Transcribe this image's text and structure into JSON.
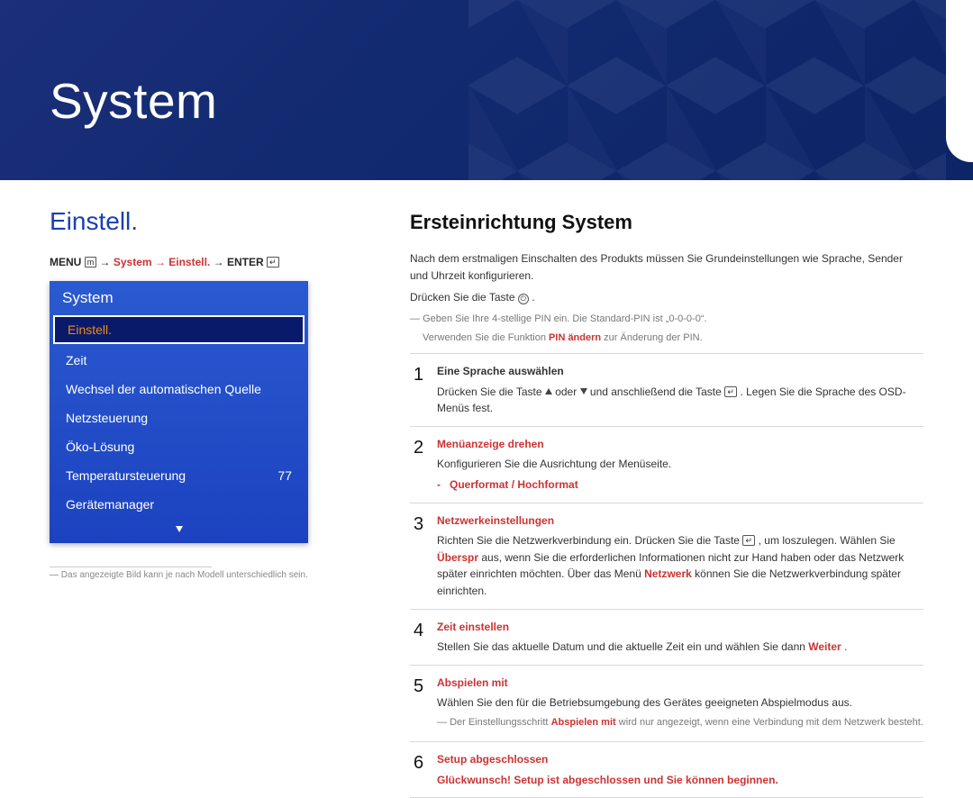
{
  "hero": {
    "title": "System"
  },
  "left": {
    "section_title": "Einstell.",
    "breadcrumb": {
      "menu": "MENU",
      "arrow": "→",
      "red": "System → Einstell.",
      "enter": "ENTER"
    },
    "osd": {
      "title": "System",
      "rows": [
        {
          "label": "Einstell.",
          "value": "",
          "selected": true
        },
        {
          "label": "Zeit",
          "value": ""
        },
        {
          "label": "Wechsel der automatischen Quelle",
          "value": ""
        },
        {
          "label": "Netzsteuerung",
          "value": ""
        },
        {
          "label": "Öko-Lösung",
          "value": ""
        },
        {
          "label": "Temperatursteuerung",
          "value": "77"
        },
        {
          "label": "Gerätemanager",
          "value": ""
        }
      ]
    },
    "footnote": "Das angezeigte Bild kann je nach Modell unterschiedlich sein."
  },
  "right": {
    "title": "Ersteinrichtung System",
    "intro1": "Nach dem erstmaligen Einschalten des Produkts müssen Sie Grundeinstellungen wie Sprache, Sender und Uhrzeit konfigurieren.",
    "intro2_a": "Drücken Sie die Taste ",
    "intro2_b": ".",
    "note1": "Geben Sie Ihre 4-stellige PIN ein. Die Standard-PIN ist „0-0-0-0“.",
    "note2_a": "Verwenden Sie die Funktion ",
    "note2_red": "PIN ändern",
    "note2_b": " zur Änderung der PIN.",
    "steps": {
      "s1": {
        "head": "Eine Sprache auswählen",
        "body_a": "Drücken Sie die Taste ",
        "body_mid": " oder ",
        "body_b": " und anschließend die Taste ",
        "body_c": ". Legen Sie die Sprache des OSD-Menüs fest."
      },
      "s2": {
        "head": "Menüanzeige drehen",
        "body": "Konfigurieren Sie die Ausrichtung der Menüseite.",
        "sub_dash": "-",
        "sub_val": "Querformat / Hochformat"
      },
      "s3": {
        "head": "Netzwerkeinstellungen",
        "body_a": "Richten Sie die Netzwerkverbindung ein. Drücken Sie die Taste ",
        "body_b": ", um loszulegen. Wählen Sie ",
        "body_red1": "Überspr",
        "body_c": " aus, wenn Sie die erforderlichen Informationen nicht zur Hand haben oder das Netzwerk später einrichten möchten. Über das Menü ",
        "body_red2": "Netzwerk",
        "body_d": " können Sie die Netzwerkverbindung später einrichten."
      },
      "s4": {
        "head": "Zeit einstellen",
        "body_a": "Stellen Sie das aktuelle Datum und die aktuelle Zeit ein und wählen Sie dann ",
        "body_red": "Weiter",
        "body_b": "."
      },
      "s5": {
        "head": "Abspielen mit",
        "body": "Wählen Sie den für die Betriebsumgebung des Gerätes geeigneten Abspielmodus aus.",
        "note_a": "Der Einstellungsschritt ",
        "note_red": "Abspielen mit",
        "note_b": " wird nur angezeigt, wenn eine Verbindung mit dem Netzwerk besteht."
      },
      "s6": {
        "head": "Setup abgeschlossen",
        "body": "Glückwunsch! Setup ist abgeschlossen und Sie können beginnen."
      }
    }
  }
}
